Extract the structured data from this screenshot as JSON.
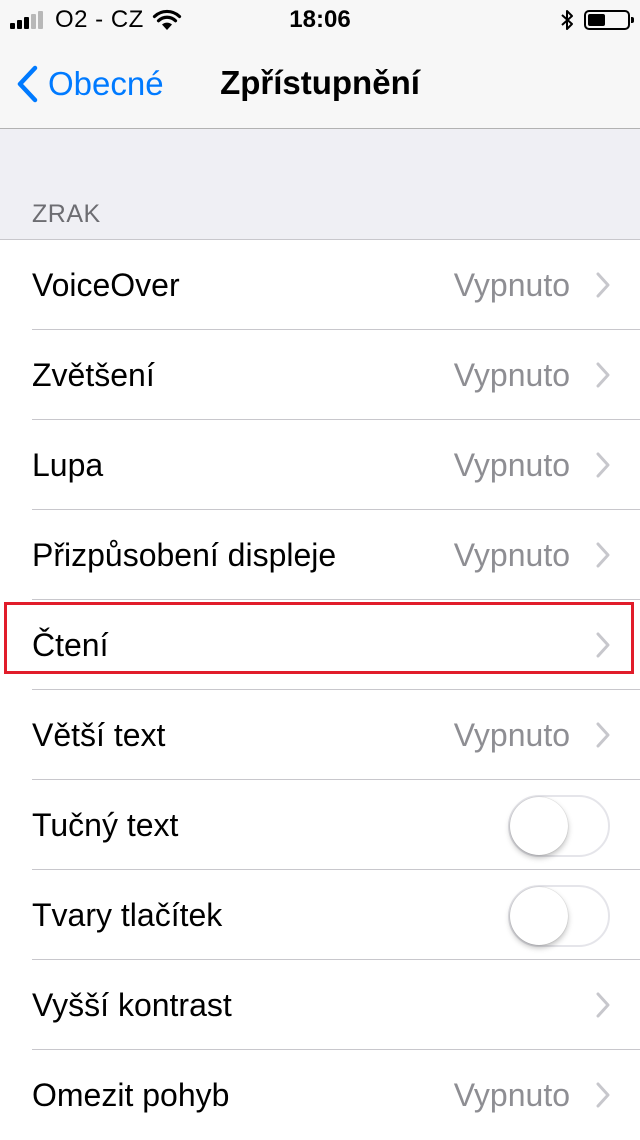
{
  "status_bar": {
    "carrier": "O2 - CZ",
    "time": "18:06",
    "signal_bars_filled": 3,
    "signal_bars_total": 5,
    "battery_level": 0.45,
    "icons": [
      "wifi-icon",
      "bluetooth-icon",
      "battery-icon"
    ]
  },
  "nav": {
    "back_label": "Obecné",
    "title": "Zpřístupnění"
  },
  "section": {
    "header": "ZRAK"
  },
  "rows": [
    {
      "label": "VoiceOver",
      "value": "Vypnuto",
      "accessory": "chevron"
    },
    {
      "label": "Zvětšení",
      "value": "Vypnuto",
      "accessory": "chevron"
    },
    {
      "label": "Lupa",
      "value": "Vypnuto",
      "accessory": "chevron"
    },
    {
      "label": "Přizpůsobení displeje",
      "value": "Vypnuto",
      "accessory": "chevron"
    },
    {
      "label": "Čtení",
      "value": "",
      "accessory": "chevron",
      "highlighted": true
    },
    {
      "label": "Větší text",
      "value": "Vypnuto",
      "accessory": "chevron"
    },
    {
      "label": "Tučný text",
      "accessory": "toggle",
      "on": false
    },
    {
      "label": "Tvary tlačítek",
      "accessory": "toggle",
      "on": false
    },
    {
      "label": "Vyšší kontrast",
      "value": "",
      "accessory": "chevron"
    },
    {
      "label": "Omezit pohyb",
      "value": "Vypnuto",
      "accessory": "chevron"
    }
  ],
  "colors": {
    "accent": "#007aff",
    "highlight_box": "#e11c2a",
    "secondary_text": "#8e8e93",
    "background": "#efeff4"
  }
}
